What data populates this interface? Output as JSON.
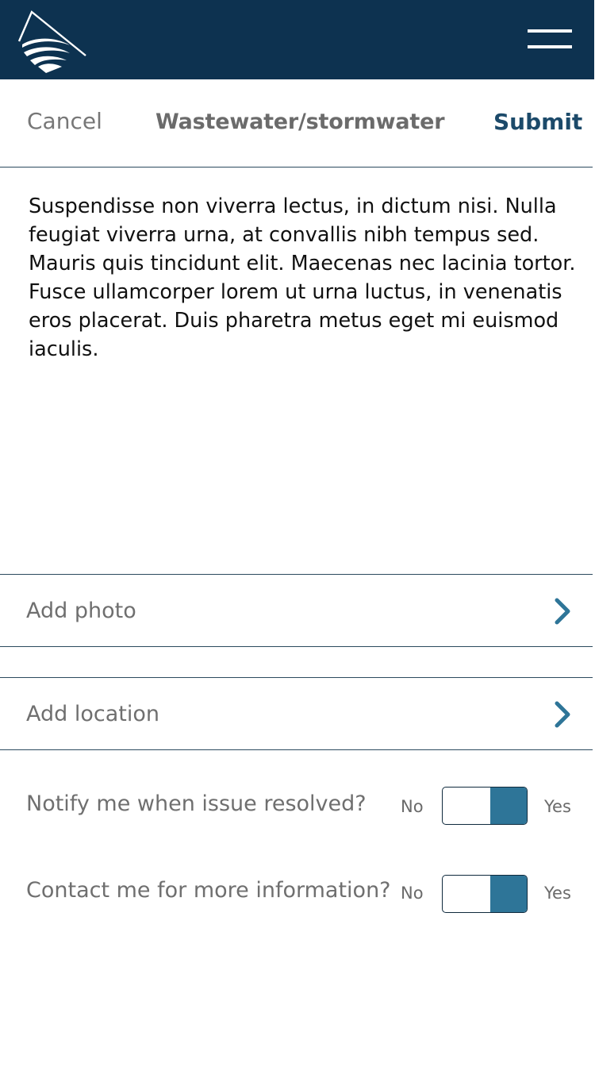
{
  "header": {
    "logo_icon": "mountain-water-logo",
    "menu_icon": "hamburger-menu-icon",
    "background_color": "#0d3250"
  },
  "titlebar": {
    "cancel_label": "Cancel",
    "title": "Wastewater/stormwater",
    "submit_label": "Submit"
  },
  "description": "Suspendisse non viverra lectus, in dictum nisi. Nulla feugiat viverra urna, at convallis nibh tempus sed. Mauris quis tincidunt elit. Maecenas nec lacinia tortor. Fusce ullamcorper lorem ut urna luctus, in venenatis eros placerat. Duis pharetra metus eget mi euismod iaculis.",
  "actions": [
    {
      "label": "Add photo",
      "icon": "chevron-right-icon"
    },
    {
      "label": "Add location",
      "icon": "chevron-right-icon"
    }
  ],
  "toggles": [
    {
      "label": "Notify me when issue resolved?",
      "off_label": "No",
      "on_label": "Yes",
      "value": "Yes"
    },
    {
      "label": "Contact me for more information?",
      "off_label": "No",
      "on_label": "Yes",
      "value": "Yes"
    }
  ],
  "colors": {
    "accent": "#2e7598",
    "submit": "#1c4a6a",
    "divider": "#2b4a5e"
  }
}
